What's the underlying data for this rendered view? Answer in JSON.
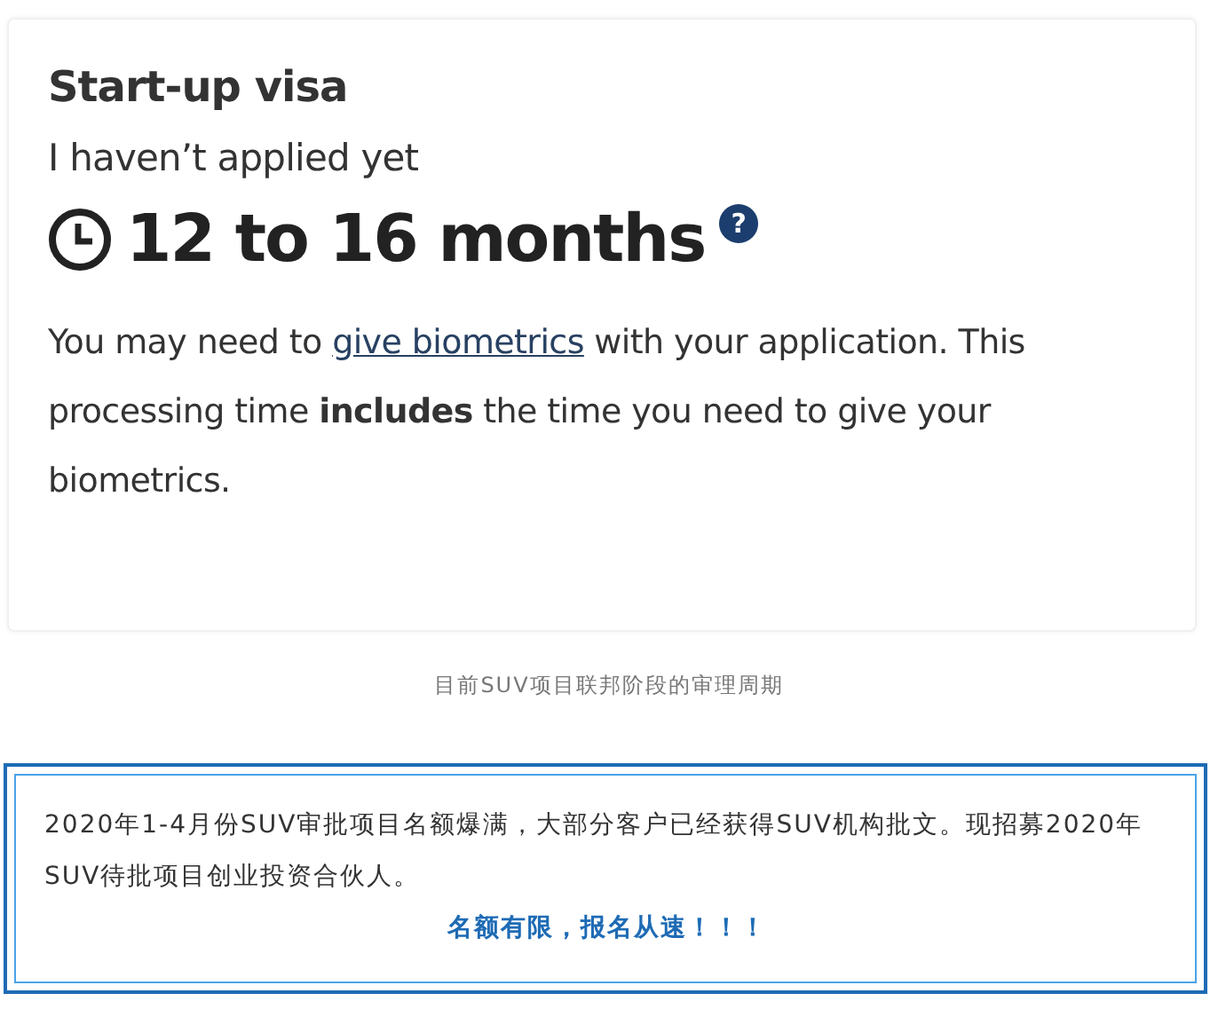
{
  "card": {
    "title": "Start-up visa",
    "status": "I haven’t applied yet",
    "duration": "12 to 16 months",
    "help_icon": "?",
    "note": {
      "before": "You may need to ",
      "link": "give biometrics",
      "after": " with your application. This processing time **includes** the time you need to give your biometrics."
    }
  },
  "caption": "目前SUV项目联邦阶段的审理周期",
  "notice": {
    "text": "2020年1-4月份SUV审批项目名额爆满，大部分客户已经获得SUV机构批文。现招募2020年SUV待批项目创业投资合伙人。",
    "highlight": "名额有限，报名从速！！！"
  }
}
